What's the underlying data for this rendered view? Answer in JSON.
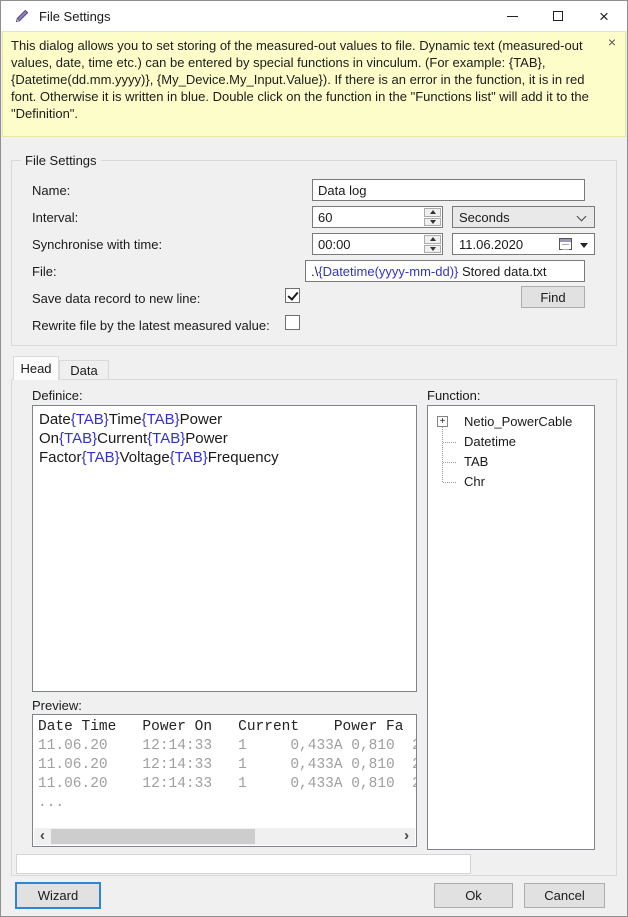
{
  "window": {
    "title": "File Settings"
  },
  "banner": {
    "text": "This dialog allows you to set storing of the measured-out values to file. Dynamic text (measured-out values, date, time etc.) can be entered by special functions in vinculum. (For example: {TAB}, {Datetime(dd.mm.yyyy)}, {My_Device.My_Input.Value}). If there is an error in the function, it is in red font. Otherwise it is written in blue. Double click on the function in the \"Functions list\" will add it to the \"Definition\".",
    "close": "×",
    "background": "#fdfdca"
  },
  "group": {
    "legend": "File Settings",
    "rows": {
      "name": {
        "label": "Name:",
        "value": "Data log"
      },
      "interval": {
        "label": "Interval:",
        "value": "60",
        "unit": "Seconds"
      },
      "sync": {
        "label": "Synchronise with time:",
        "time": "00:00",
        "date": "11.06.2020"
      },
      "file": {
        "label": "File:",
        "segments": [
          {
            "text": ".\\",
            "type": "plain"
          },
          {
            "text": "{Datetime(yyyy-mm-dd)}",
            "type": "func"
          },
          {
            "text": " Stored data.txt",
            "type": "plain"
          }
        ]
      },
      "save_line": {
        "label": "Save data record to new line:",
        "checked": true
      },
      "rewrite": {
        "label": "Rewrite file by the latest measured value:",
        "checked": false
      }
    },
    "find_button": "Find"
  },
  "tabs": {
    "head": "Head",
    "data": "Data"
  },
  "definition": {
    "label": "Definice:",
    "segments": [
      {
        "text": "Date",
        "type": "plain"
      },
      {
        "text": "{TAB}",
        "type": "func"
      },
      {
        "text": "Time",
        "type": "plain"
      },
      {
        "text": "{TAB}",
        "type": "func"
      },
      {
        "text": "Power On",
        "type": "plain"
      },
      {
        "text": "{TAB}",
        "type": "func"
      },
      {
        "text": "Current",
        "type": "plain"
      },
      {
        "text": "{TAB}",
        "type": "func"
      },
      {
        "text": "Power Factor",
        "type": "plain"
      },
      {
        "text": "{TAB}",
        "type": "func"
      },
      {
        "text": "Voltage",
        "type": "plain"
      },
      {
        "text": "{TAB}",
        "type": "func"
      },
      {
        "text": "Frequency",
        "type": "plain"
      }
    ]
  },
  "functions": {
    "label": "Function:",
    "items": [
      {
        "label": "Netio_PowerCable",
        "expandable": true
      },
      {
        "label": "Datetime",
        "expandable": false
      },
      {
        "label": "TAB",
        "expandable": false
      },
      {
        "label": "Chr",
        "expandable": false
      }
    ]
  },
  "preview": {
    "label": "Preview:",
    "lines": [
      {
        "text": "Date Time   Power On   Current    Power Fa",
        "style": "header"
      },
      {
        "text": "11.06.20    12:14:33   1     0,433A 0,810  2",
        "style": "data"
      },
      {
        "text": "11.06.20    12:14:33   1     0,433A 0,810  2",
        "style": "data"
      },
      {
        "text": "11.06.20    12:14:33   1     0,433A 0,810  2",
        "style": "data"
      },
      {
        "text": "...",
        "style": "data"
      }
    ]
  },
  "footer": {
    "wizard": "Wizard",
    "ok": "Ok",
    "cancel": "Cancel"
  },
  "colors": {
    "function_text": "#3333cc",
    "banner_bg": "#fdfdca"
  }
}
